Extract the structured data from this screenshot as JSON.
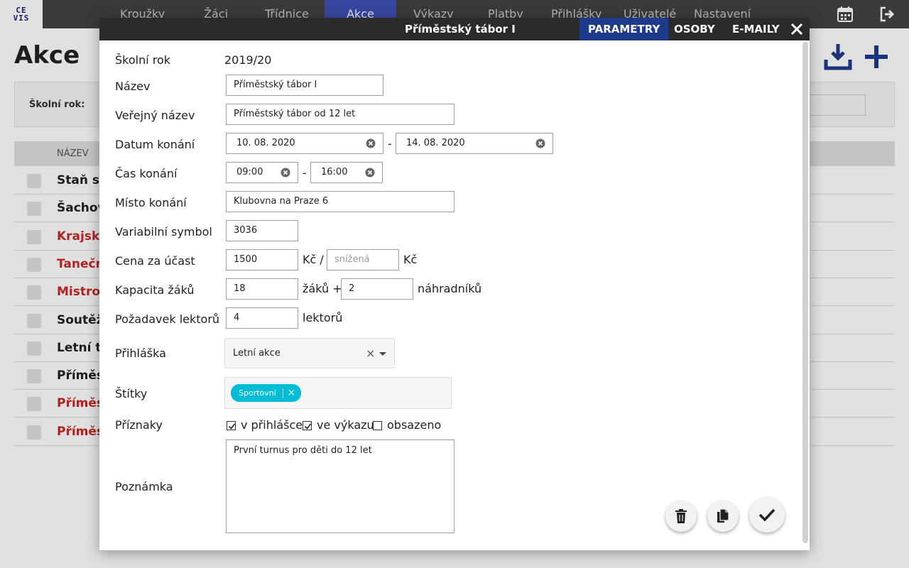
{
  "app": {
    "logo_top": "CE",
    "logo_bottom": "VIS",
    "nav": [
      "Kroužky",
      "Žáci",
      "Třídnice",
      "Akce",
      "Výkazy",
      "Platby",
      "Přihlášky",
      "Uživatelé",
      "Nastavení"
    ],
    "active_nav": "Akce",
    "icons": [
      "calendar-icon",
      "logout-icon",
      "download-icon",
      "plus-icon"
    ],
    "accent_color": "#3f51b5"
  },
  "page": {
    "title": "Akce",
    "filter_label": "Školní rok:",
    "column_header": "NÁZEV",
    "rows": [
      {
        "label": "Staň se",
        "color": "#222222"
      },
      {
        "label": "Šachov",
        "color": "#222222"
      },
      {
        "label": "Krajský",
        "color": "#c62828"
      },
      {
        "label": "Taneční",
        "color": "#c62828"
      },
      {
        "label": "Mistrov",
        "color": "#c62828"
      },
      {
        "label": "Soutěž",
        "color": "#222222"
      },
      {
        "label": "Letní ta",
        "color": "#222222"
      },
      {
        "label": "Příměs",
        "color": "#222222"
      },
      {
        "label": "Příměs",
        "color": "#c62828"
      },
      {
        "label": "Příměs",
        "color": "#c62828"
      }
    ]
  },
  "modal": {
    "title": "Příměstský tábor I",
    "tabs": [
      "PARAMETRY",
      "OSOBY",
      "E-MAILY"
    ],
    "active_tab": "PARAMETRY",
    "tab_active_color": "#1e3a8a",
    "fields": {
      "school_year": {
        "label": "Školní rok",
        "value": "2019/20"
      },
      "name": {
        "label": "Název",
        "value": "Příměstský tábor I"
      },
      "public_name": {
        "label": "Veřejný název",
        "value": "Příměstský tábor od 12 let"
      },
      "date": {
        "label": "Datum konání",
        "from": "10. 08. 2020",
        "to": "14. 08. 2020",
        "separator": "-"
      },
      "time": {
        "label": "Čas konání",
        "from": "09:00",
        "to": "16:00",
        "separator": "-"
      },
      "place": {
        "label": "Místo konání",
        "value": "Klubovna na Praze 6"
      },
      "variable_symbol": {
        "label": "Variabilní symbol",
        "value": "3036"
      },
      "price": {
        "label": "Cena za účast",
        "value": "1500",
        "unit1": "Kč /",
        "reduced_placeholder": "snížená",
        "unit2": "Kč"
      },
      "capacity": {
        "label": "Kapacita žáků",
        "value": "18",
        "mid": "žáků +",
        "substitutes": "2",
        "unit": "náhradníků"
      },
      "lecturers": {
        "label": "Požadavek lektorů",
        "value": "4",
        "unit": "lektorů"
      },
      "application": {
        "label": "Přihláška",
        "value": "Letní akce",
        "clear": "×"
      },
      "tags": {
        "label": "Štítky",
        "items": [
          {
            "label": "Sportovní",
            "remove": "×",
            "color": "#00bcd4"
          }
        ]
      },
      "flags": {
        "label": "Příznaky",
        "items": [
          {
            "label": "v přihlášce",
            "checked": true
          },
          {
            "label": "ve výkazu",
            "checked": true
          },
          {
            "label": "obsazeno",
            "checked": false
          }
        ]
      },
      "note": {
        "label": "Poznámka",
        "value": "První turnus pro děti do 12 let"
      }
    },
    "actions": [
      "delete-icon",
      "copy-icon",
      "check-icon"
    ]
  }
}
